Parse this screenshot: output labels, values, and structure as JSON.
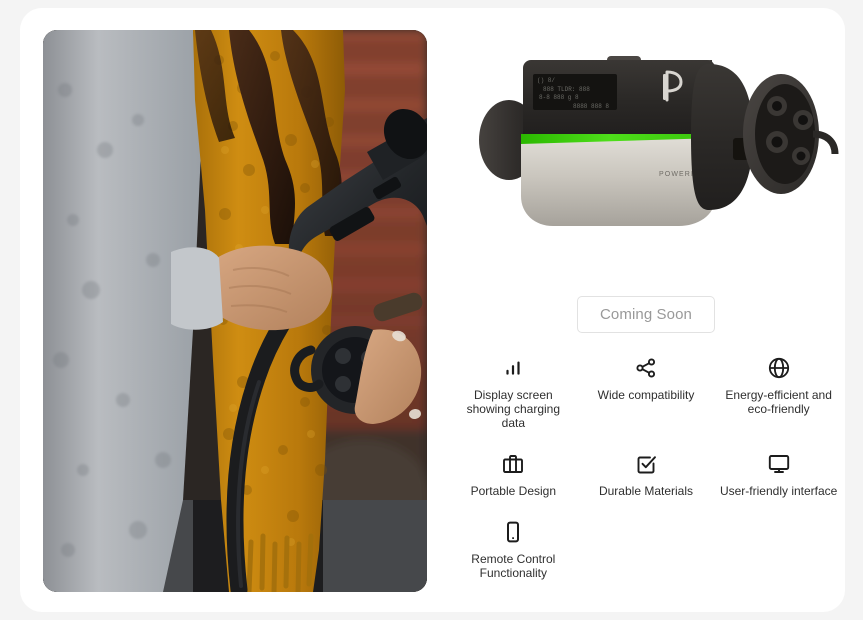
{
  "card": {
    "background_color": "#ffffff",
    "page_background_color": "#f4f4f4"
  },
  "media": {
    "alt": "Person in mustard knit scarf and grey coat holding an EV charging connector in front of a red brick wall",
    "scene_colors": {
      "scarf": "#c8860f",
      "coat": "#b9bcc0",
      "brick": "#8d4433",
      "connector": "#2b2d30",
      "skin": "#c89878"
    }
  },
  "product": {
    "name": "POWERPOD",
    "brand_mark": "P",
    "screen_lines": [
      "88 TLDR: 888",
      "8-8 888 g 8",
      "8888 888 8"
    ],
    "colors": {
      "body_dark": "#2e2c2b",
      "body_light": "#c9c5bd",
      "accent_green": "#3ec90f",
      "connector": "#35322f"
    }
  },
  "cta": {
    "label": "Coming Soon",
    "state": "disabled",
    "text_color": "#999999",
    "border_color": "#e2e2e2"
  },
  "features": [
    {
      "icon": "bar-chart-icon",
      "label": "Display screen showing charging data"
    },
    {
      "icon": "share-nodes-icon",
      "label": "Wide compatibility"
    },
    {
      "icon": "globe-icon",
      "label": "Energy-efficient and eco-friendly"
    },
    {
      "icon": "briefcase-icon",
      "label": "Portable Design"
    },
    {
      "icon": "check-square-icon",
      "label": "Durable Materials"
    },
    {
      "icon": "monitor-icon",
      "label": "User-friendly interface"
    },
    {
      "icon": "mobile-phone-icon",
      "label": "Remote Control Functionality"
    }
  ]
}
